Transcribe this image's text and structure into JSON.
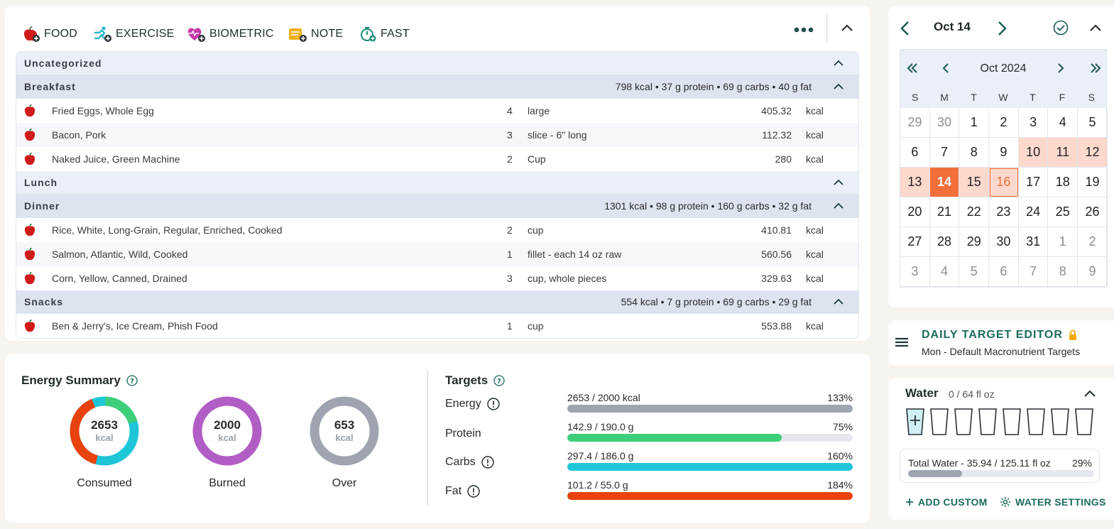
{
  "toolbar": {
    "food_label": "FOOD",
    "exercise_label": "EXERCISE",
    "biometric_label": "BIOMETRIC",
    "note_label": "NOTE",
    "fast_label": "FAST"
  },
  "diary": {
    "groups": [
      {
        "name": "Uncategorized",
        "summary": "",
        "items": []
      },
      {
        "name": "Breakfast",
        "summary": "798 kcal • 37 g protein • 69 g carbs • 40 g fat",
        "items": [
          {
            "name": "Fried Eggs, Whole Egg",
            "qty": "4",
            "unit": "large",
            "kcal": "405.32",
            "kunit": "kcal"
          },
          {
            "name": "Bacon, Pork",
            "qty": "3",
            "unit": "slice - 6\" long",
            "kcal": "112.32",
            "kunit": "kcal"
          },
          {
            "name": "Naked Juice, Green Machine",
            "qty": "2",
            "unit": "Cup",
            "kcal": "280",
            "kunit": "kcal"
          }
        ]
      },
      {
        "name": "Lunch",
        "summary": "",
        "items": []
      },
      {
        "name": "Dinner",
        "summary": "1301 kcal • 98 g protein • 160 g carbs • 32 g fat",
        "items": [
          {
            "name": "Rice, White, Long-Grain, Regular, Enriched, Cooked",
            "qty": "2",
            "unit": "cup",
            "kcal": "410.81",
            "kunit": "kcal"
          },
          {
            "name": "Salmon, Atlantic, Wild, Cooked",
            "qty": "1",
            "unit": "fillet - each 14 oz raw",
            "kcal": "560.56",
            "kunit": "kcal"
          },
          {
            "name": "Corn, Yellow, Canned, Drained",
            "qty": "3",
            "unit": "cup, whole pieces",
            "kcal": "329.63",
            "kunit": "kcal"
          }
        ]
      },
      {
        "name": "Snacks",
        "summary": "554 kcal • 7 g protein • 69 g carbs • 29 g fat",
        "items": [
          {
            "name": "Ben & Jerry's, Ice Cream, Phish Food",
            "qty": "1",
            "unit": "cup",
            "kcal": "553.88",
            "kunit": "kcal"
          }
        ]
      }
    ]
  },
  "energy": {
    "title": "Energy Summary",
    "consumed": {
      "value": "2653",
      "unit": "kcal",
      "label": "Consumed"
    },
    "burned": {
      "value": "2000",
      "unit": "kcal",
      "label": "Burned"
    },
    "over": {
      "value": "653",
      "unit": "kcal",
      "label": "Over"
    }
  },
  "targets": {
    "title": "Targets",
    "rows": [
      {
        "label": "Energy",
        "text": "2653 / 2000 kcal",
        "pct": "133%",
        "fill": 1.0,
        "color": "#9fa4b0"
      },
      {
        "label": "Protein",
        "text": "142.9 / 190.0 g",
        "pct": "75%",
        "fill": 0.75,
        "color": "#3ecf7a"
      },
      {
        "label": "Carbs",
        "text": "297.4 / 186.0 g",
        "pct": "160%",
        "fill": 1.0,
        "color": "#1fc6d8"
      },
      {
        "label": "Fat",
        "text": "101.2 / 55.0 g",
        "pct": "184%",
        "fill": 1.0,
        "color": "#e8420e"
      }
    ]
  },
  "calendar": {
    "date_label": "Oct 14",
    "month_label": "Oct 2024",
    "dow": [
      "S",
      "M",
      "T",
      "W",
      "T",
      "F",
      "S"
    ],
    "days": [
      {
        "d": "29",
        "s": "muted"
      },
      {
        "d": "30",
        "s": "muted"
      },
      {
        "d": "1",
        "s": ""
      },
      {
        "d": "2",
        "s": ""
      },
      {
        "d": "3",
        "s": ""
      },
      {
        "d": "4",
        "s": ""
      },
      {
        "d": "5",
        "s": ""
      },
      {
        "d": "6",
        "s": ""
      },
      {
        "d": "7",
        "s": ""
      },
      {
        "d": "8",
        "s": ""
      },
      {
        "d": "9",
        "s": ""
      },
      {
        "d": "10",
        "s": "range"
      },
      {
        "d": "11",
        "s": "range"
      },
      {
        "d": "12",
        "s": "range"
      },
      {
        "d": "13",
        "s": "range"
      },
      {
        "d": "14",
        "s": "sel"
      },
      {
        "d": "15",
        "s": "range"
      },
      {
        "d": "16",
        "s": "today"
      },
      {
        "d": "17",
        "s": ""
      },
      {
        "d": "18",
        "s": ""
      },
      {
        "d": "19",
        "s": ""
      },
      {
        "d": "20",
        "s": ""
      },
      {
        "d": "21",
        "s": ""
      },
      {
        "d": "22",
        "s": ""
      },
      {
        "d": "23",
        "s": ""
      },
      {
        "d": "24",
        "s": ""
      },
      {
        "d": "25",
        "s": ""
      },
      {
        "d": "26",
        "s": ""
      },
      {
        "d": "27",
        "s": ""
      },
      {
        "d": "28",
        "s": ""
      },
      {
        "d": "29",
        "s": ""
      },
      {
        "d": "30",
        "s": ""
      },
      {
        "d": "31",
        "s": ""
      },
      {
        "d": "1",
        "s": "muted"
      },
      {
        "d": "2",
        "s": "muted"
      },
      {
        "d": "3",
        "s": "muted"
      },
      {
        "d": "4",
        "s": "muted"
      },
      {
        "d": "5",
        "s": "muted"
      },
      {
        "d": "6",
        "s": "muted"
      },
      {
        "d": "7",
        "s": "muted"
      },
      {
        "d": "8",
        "s": "muted"
      },
      {
        "d": "9",
        "s": "muted"
      }
    ]
  },
  "target_editor": {
    "title": "DAILY TARGET EDITOR",
    "subtitle": "Mon - Default Macronutrient Targets"
  },
  "water": {
    "title": "Water",
    "subtitle": "0 / 64 fl oz",
    "total_label": "Total Water - 35.94 / 125.11 fl oz",
    "total_pct": "29%",
    "total_fill": 0.29,
    "add_custom": "ADD CUSTOM",
    "settings": "WATER SETTINGS"
  },
  "colors": {
    "accent": "#1a6b5c",
    "selected_day": "#f36f3a",
    "range_day": "#fcd9cc"
  }
}
